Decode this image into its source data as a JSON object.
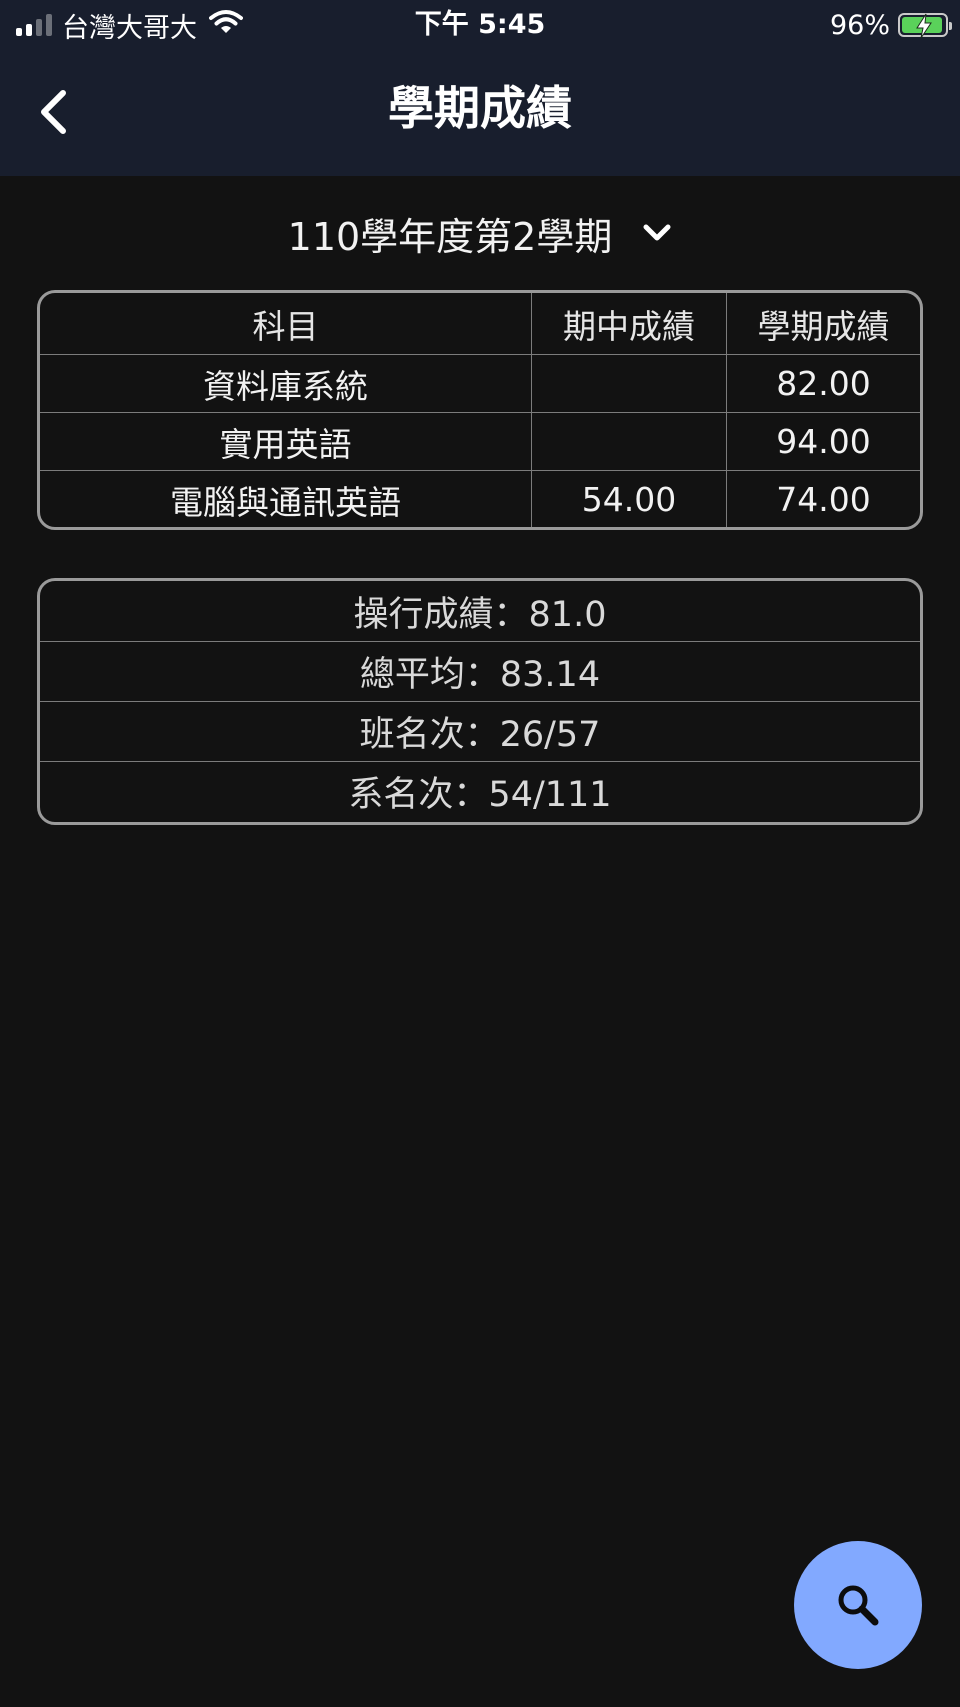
{
  "status_bar": {
    "carrier": "台灣大哥大",
    "time": "下午 5:45",
    "battery_percent": "96%",
    "battery_level": 0.96,
    "charging": true,
    "icons": [
      "signal-icon",
      "wifi-icon",
      "battery-icon"
    ]
  },
  "header": {
    "title": "學期成績",
    "back_icon": "chevron-left-icon"
  },
  "semester_selector": {
    "selected": "110學年度第2學期",
    "icon": "chevron-down-icon"
  },
  "score_table": {
    "columns": [
      "科目",
      "期中成績",
      "學期成績"
    ],
    "rows": [
      {
        "subject": "資料庫系統",
        "midterm": "",
        "semester": "82.00"
      },
      {
        "subject": "實用英語",
        "midterm": "",
        "semester": "94.00"
      },
      {
        "subject": "電腦與通訊英語",
        "midterm": "54.00",
        "semester": "74.00"
      }
    ]
  },
  "summary": {
    "conduct": "操行成績：81.0",
    "average": "總平均：83.14",
    "class_rank": "班名次：26/57",
    "department_rank": "系名次：54/111"
  },
  "fab": {
    "icon": "search-icon",
    "color": "#82a9ff"
  },
  "colors": {
    "background": "#121212",
    "header": "#181e2d",
    "border": "#9a9a9a",
    "battery_fill": "#5ad15a"
  }
}
